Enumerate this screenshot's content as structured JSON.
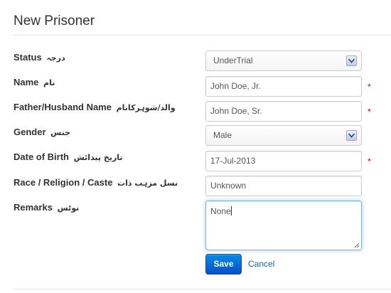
{
  "page": {
    "title": "New Prisoner"
  },
  "form": {
    "status": {
      "label": "Status",
      "label_urdu": "درجہ",
      "value": "UnderTrial",
      "required": false
    },
    "name": {
      "label": "Name",
      "label_urdu": "نام",
      "value": "John Doe, Jr.",
      "required": true
    },
    "father_husband_name": {
      "label": "Father/Husband Name",
      "label_urdu": "والد/شوہرکانام",
      "value": "John Doe, Sr.",
      "required": true
    },
    "gender": {
      "label": "Gender",
      "label_urdu": "جنس",
      "value": "Male",
      "required": false
    },
    "date_of_birth": {
      "label": "Date of Birth",
      "label_urdu": "تاریخ پیدائش",
      "value": "17-Jul-2013",
      "required": true
    },
    "race_religion_caste": {
      "label": "Race / Religion / Caste",
      "label_urdu": "نسل مزہب ذات",
      "value": "Unknown",
      "required": false
    },
    "remarks": {
      "label": "Remarks",
      "label_urdu": "نوٹس",
      "value": "None",
      "required": false
    },
    "required_marker": "*"
  },
  "actions": {
    "save_label": "Save",
    "cancel_label": "Cancel"
  },
  "colors": {
    "primary_button": "#0450c9",
    "link": "#0a66cc",
    "required": "#cc0000",
    "focus_border": "#7fb3e6"
  },
  "icons": {
    "select_arrow": "chevron-down-icon"
  }
}
